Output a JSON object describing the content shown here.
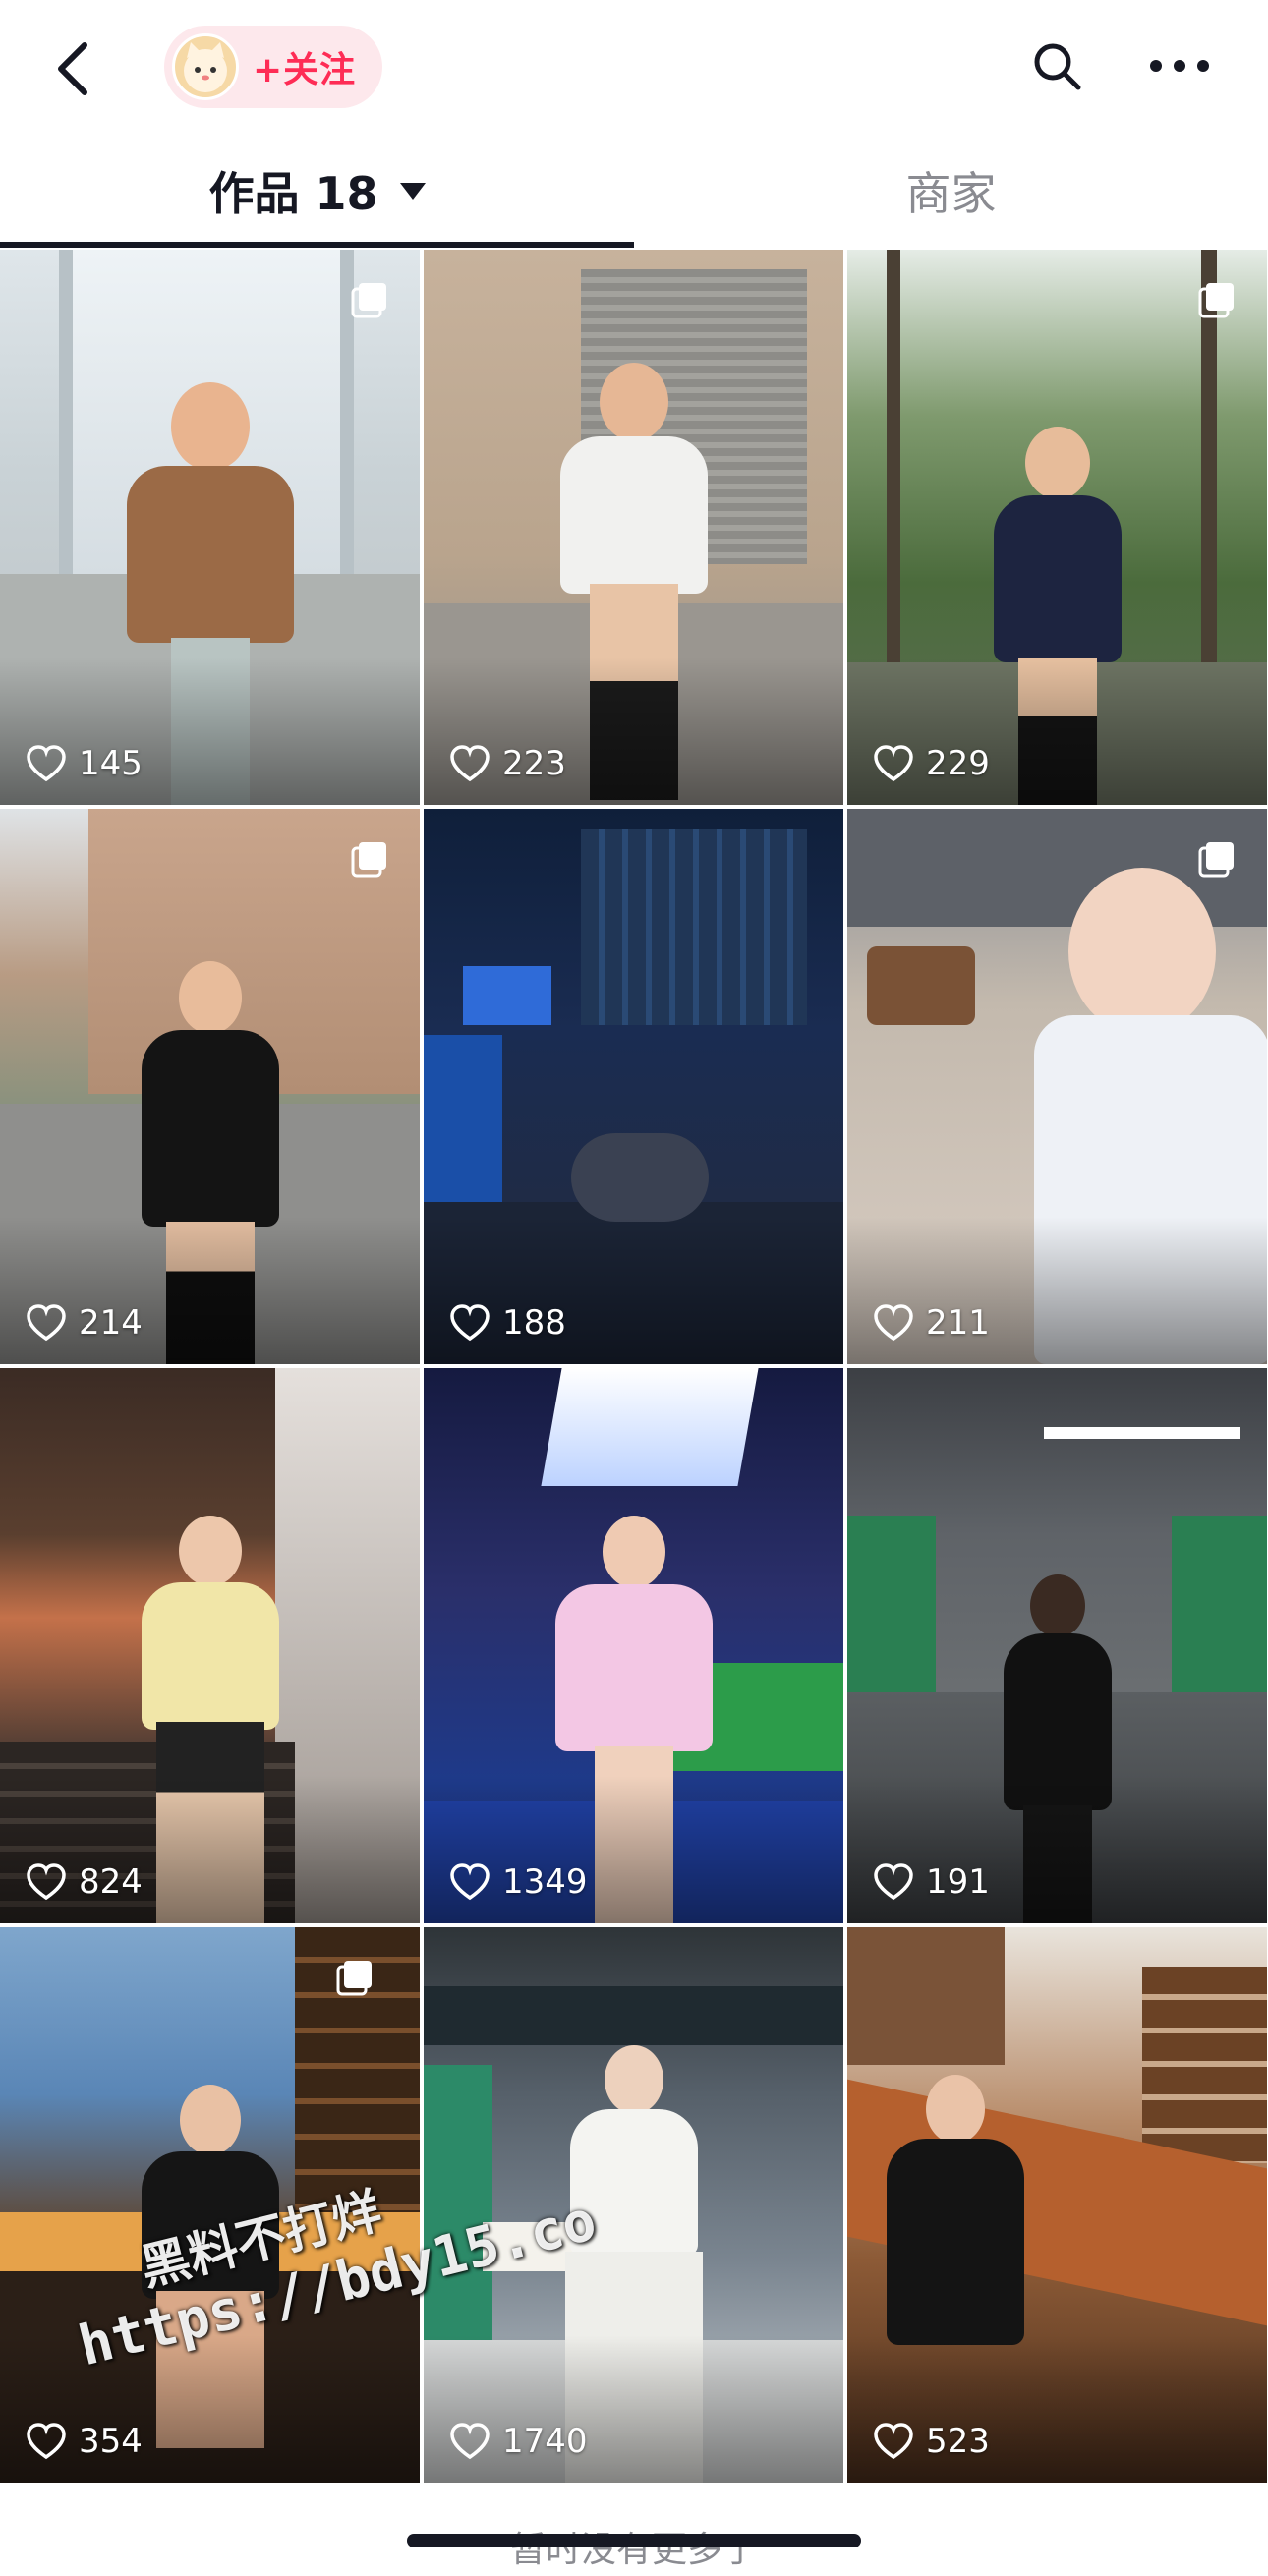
{
  "header": {
    "follow_label": "+关注",
    "back_icon": "chevron-left-icon",
    "search_icon": "search-icon",
    "more_icon": "more-dots-icon"
  },
  "tabs": [
    {
      "label": "作品 18",
      "active": true
    },
    {
      "label": "商家",
      "active": false
    }
  ],
  "posts": [
    {
      "likes": "145",
      "multi": true
    },
    {
      "likes": "223",
      "multi": false
    },
    {
      "likes": "229",
      "multi": true
    },
    {
      "likes": "214",
      "multi": true
    },
    {
      "likes": "188",
      "multi": false
    },
    {
      "likes": "211",
      "multi": true
    },
    {
      "likes": "824",
      "multi": false
    },
    {
      "likes": "1349",
      "multi": false
    },
    {
      "likes": "191",
      "multi": false
    },
    {
      "likes": "354",
      "multi": true
    },
    {
      "likes": "1740",
      "multi": false
    },
    {
      "likes": "523",
      "multi": false
    }
  ],
  "watermark": {
    "line1": "黑料不打烊",
    "line2": "https://bdy15.co"
  },
  "footer": {
    "text": "暂时没有更多了"
  },
  "colors": {
    "accent": "#fe2c55",
    "text": "#161823",
    "muted": "#8a8b91"
  }
}
